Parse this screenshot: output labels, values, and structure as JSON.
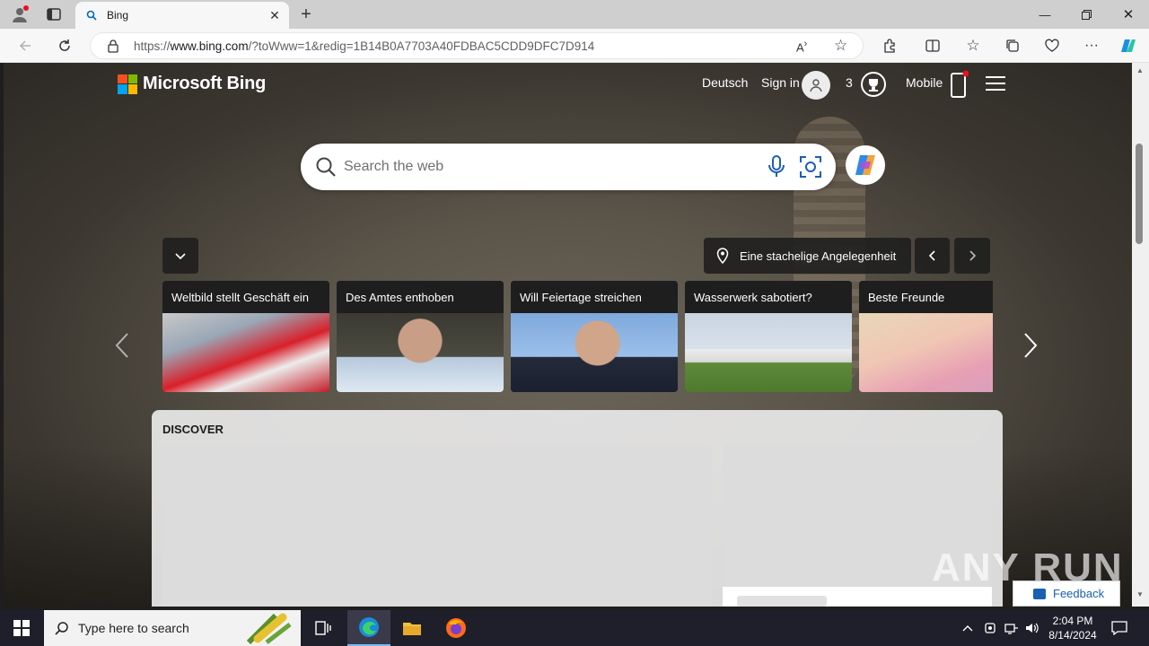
{
  "browser": {
    "tab_title": "Bing",
    "url_prefix": "https://",
    "url_domain": "www.bing.com",
    "url_rest": "/?toWww=1&redig=1B14B0A7703A40FDBAC5CDD9DFC7D914"
  },
  "bing": {
    "brand": "Microsoft Bing",
    "language": "Deutsch",
    "sign_in": "Sign in",
    "rewards_count": "3",
    "mobile": "Mobile",
    "search_placeholder": "Search the web",
    "location_label": "Eine stachelige Angelegenheit",
    "news": [
      {
        "title": "Weltbild stellt Geschäft ein"
      },
      {
        "title": "Des Amtes enthoben"
      },
      {
        "title": "Will Feiertage streichen"
      },
      {
        "title": "Wasserwerk sabotiert?"
      },
      {
        "title": "Beste Freunde"
      }
    ],
    "discover_label": "DISCOVER",
    "feedback": "Feedback"
  },
  "watermark": "ANY RUN",
  "taskbar": {
    "search_text": "Type here to search",
    "time": "2:04 PM",
    "date": "8/14/2024"
  },
  "colors": {
    "accent": "#0067c0",
    "notification_dot": "#e81123"
  }
}
